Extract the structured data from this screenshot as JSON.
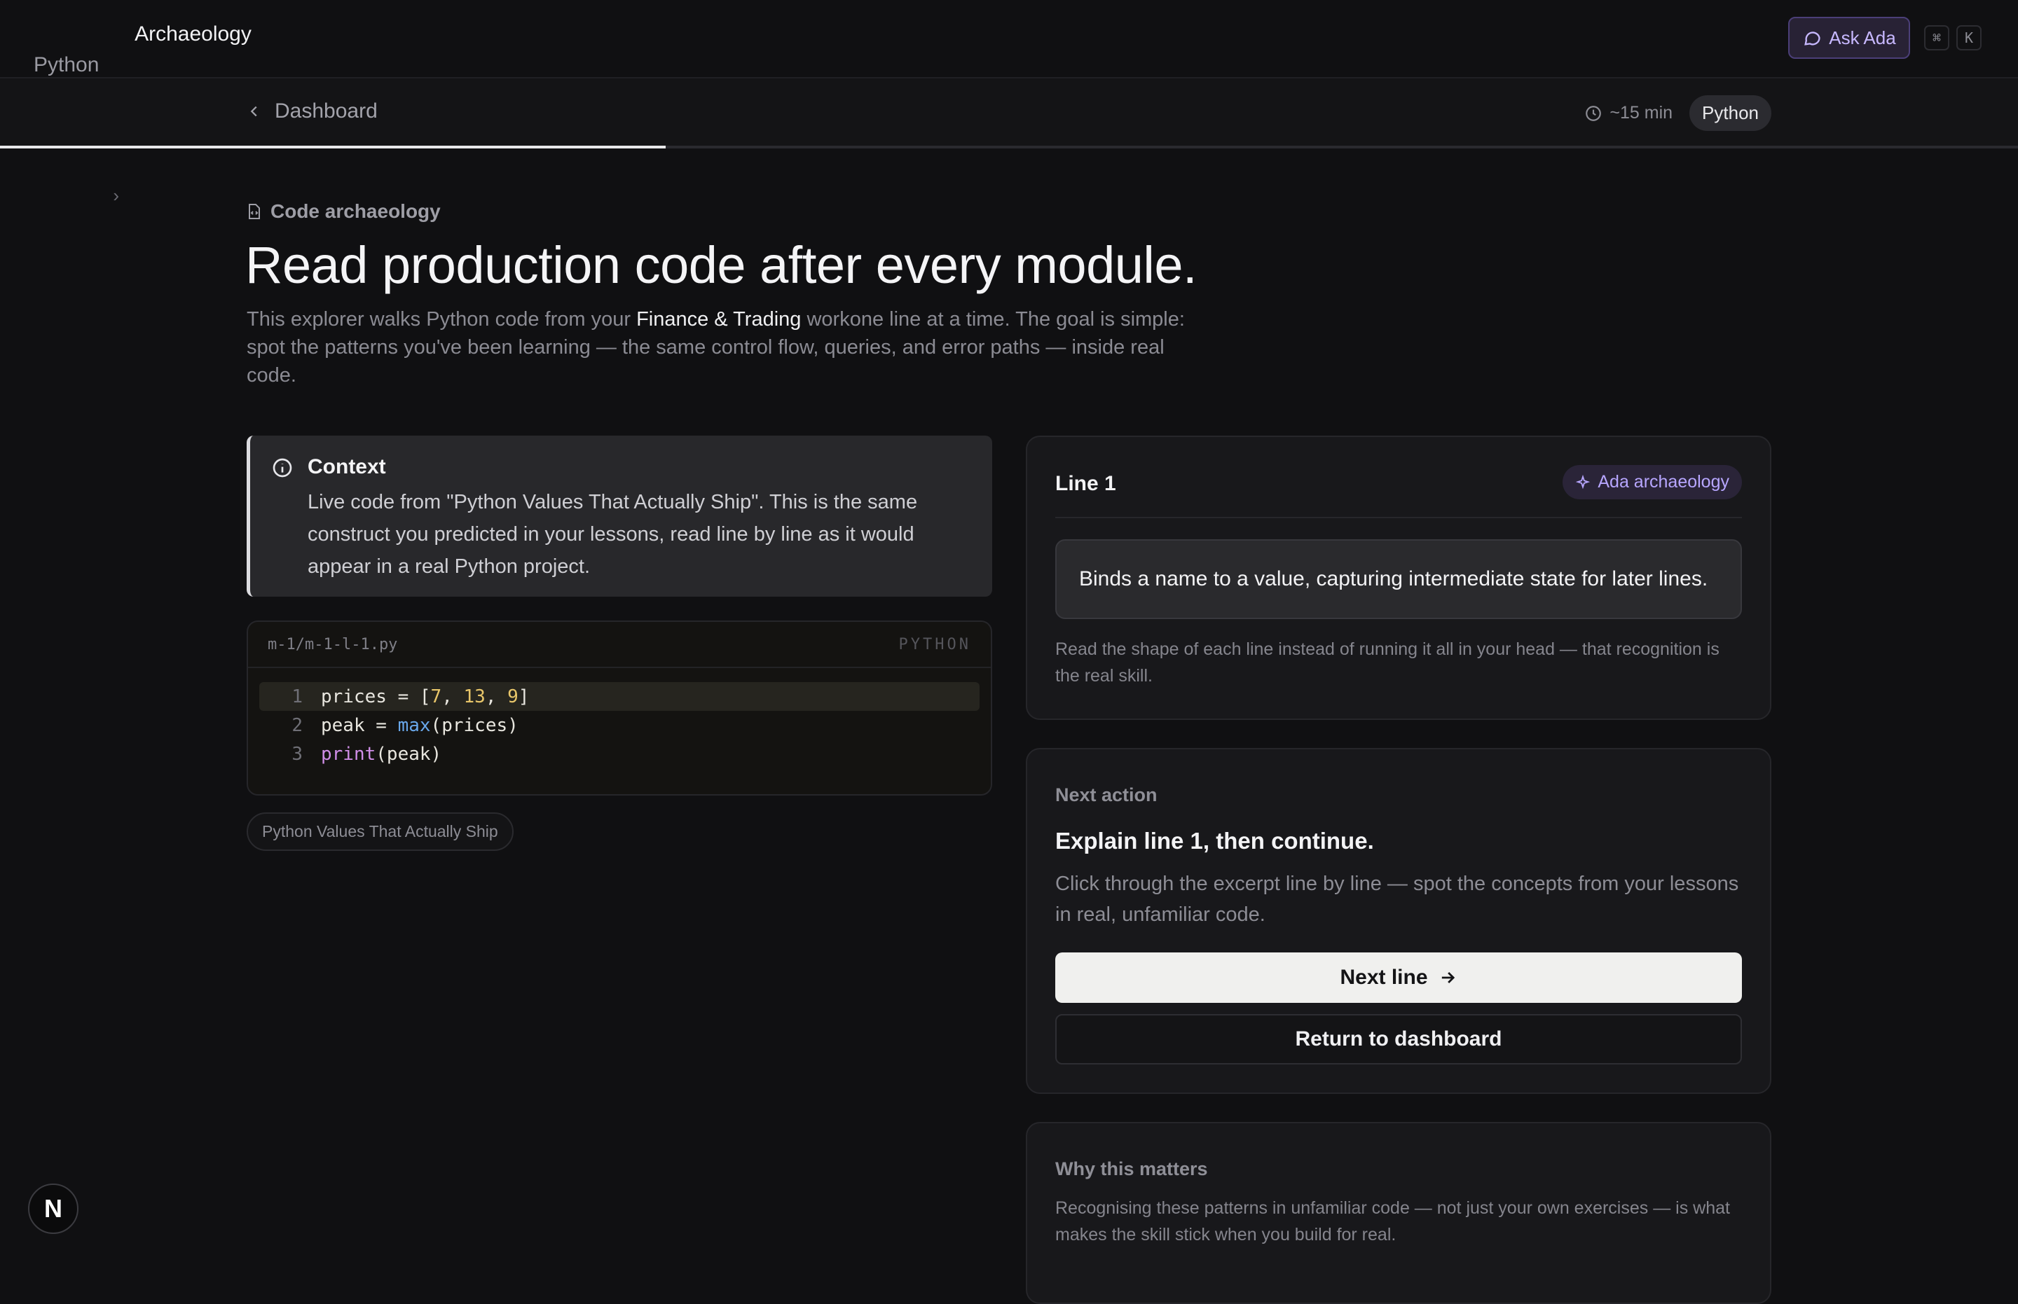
{
  "breadcrumb": {
    "root": "Python",
    "current": "Archaeology"
  },
  "ask_ada": "Ask Ada",
  "shortcut_keys": [
    "⌘",
    "K"
  ],
  "subnav": {
    "back_label": "Dashboard",
    "duration": "~15 min",
    "language": "Python"
  },
  "progress_fraction": 0.33,
  "eyebrow": "Code archaeology",
  "title": "Read production code after every module.",
  "intro": {
    "before": "This explorer walks Python code from your ",
    "highlight": "Finance & Trading",
    "after": " workone line at a time. The goal is simple: spot the patterns you've been learning — the same control flow, queries, and error paths — inside real code."
  },
  "context": {
    "title": "Context",
    "text": "Live code from \"Python Values That Actually Ship\". This is the same construct you predicted in your lessons, read line by line as it would appear in a real Python project."
  },
  "code": {
    "filename": "m-1/m-1-l-1.py",
    "language": "PYTHON",
    "line_numbers": [
      "1",
      "2",
      "3"
    ],
    "active_line": 1
  },
  "source_tag": "Python Values That Actually Ship",
  "line_card": {
    "line_label": "Line 1",
    "badge": "Ada archaeology",
    "explanation": "Binds a name to a value, capturing intermediate state for later lines.",
    "note": "Read the shape of each line instead of running it all in your head — that recognition is the real skill."
  },
  "next_action": {
    "label": "Next action",
    "heading": "Explain line 1, then continue.",
    "description": "Click through the excerpt line by line — spot the concepts from your lessons in real, unfamiliar code.",
    "primary_button": "Next line",
    "secondary_button": "Return to dashboard"
  },
  "why": {
    "label": "Why this matters",
    "text": "Recognising these patterns in unfamiliar code — not just your own exercises — is what makes the skill stick when you build for real."
  },
  "corner_logo": "N",
  "colors": {
    "accent": "#b7a6ff",
    "background": "#101012",
    "card": "#18181b"
  }
}
